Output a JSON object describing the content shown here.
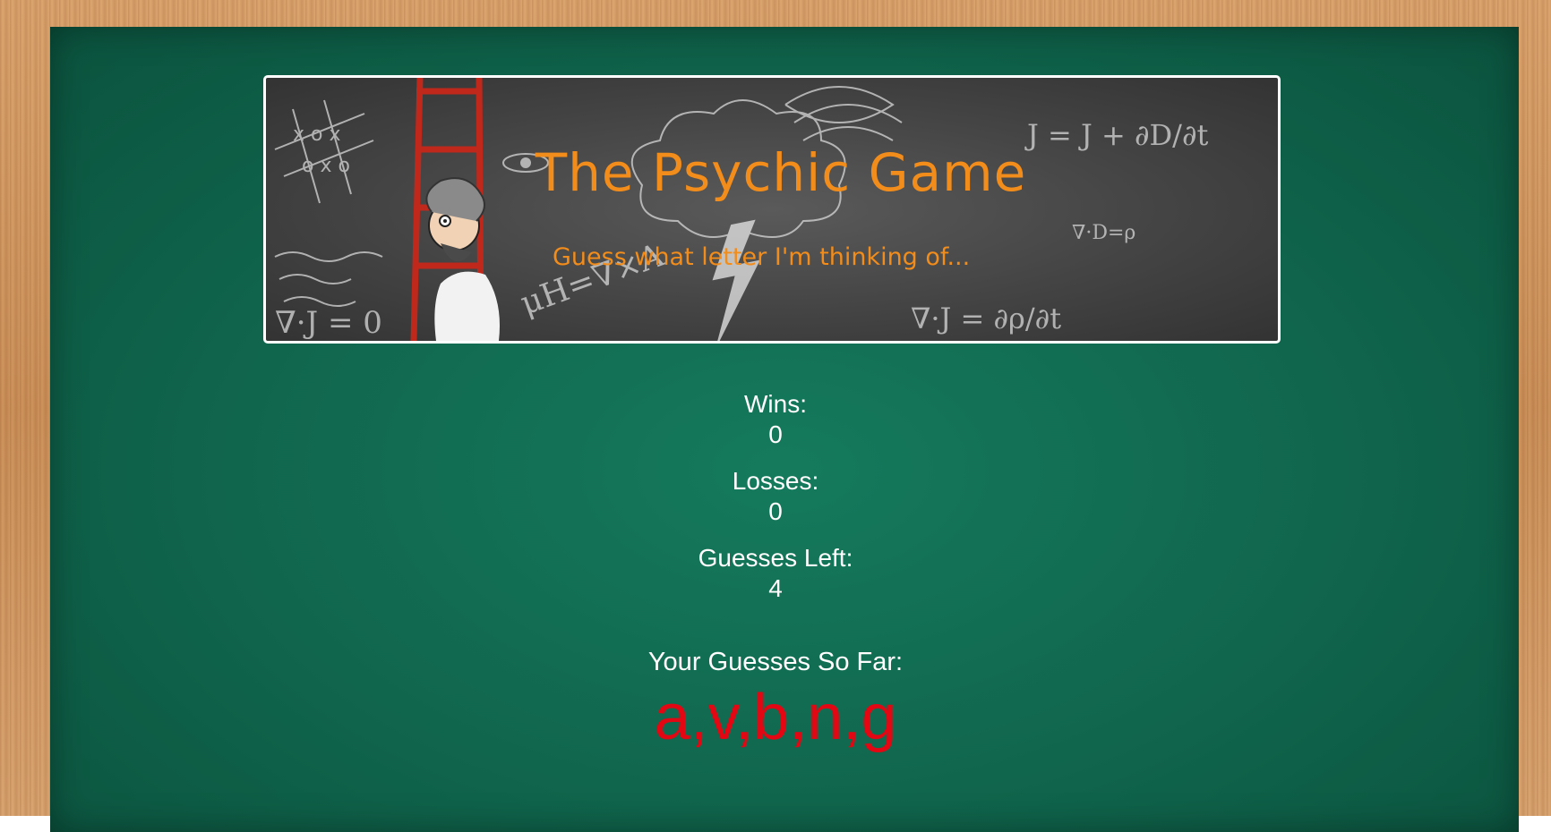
{
  "banner": {
    "title": "The Psychic Game",
    "subtitle": "Guess what letter I'm thinking of..."
  },
  "stats": {
    "wins_label": "Wins:",
    "wins_value": "0",
    "losses_label": "Losses:",
    "losses_value": "0",
    "guesses_left_label": "Guesses Left:",
    "guesses_left_value": "4"
  },
  "guesses": {
    "label": "Your Guesses So Far:",
    "value": "a,v,b,n,g"
  },
  "colors": {
    "board": "#11694f",
    "frame": "#c98c55",
    "banner_text": "#f28c1a",
    "guesses_text": "#e30613"
  },
  "icons": [
    "chalkboard-doodles",
    "scientist-ladder-illustration"
  ]
}
